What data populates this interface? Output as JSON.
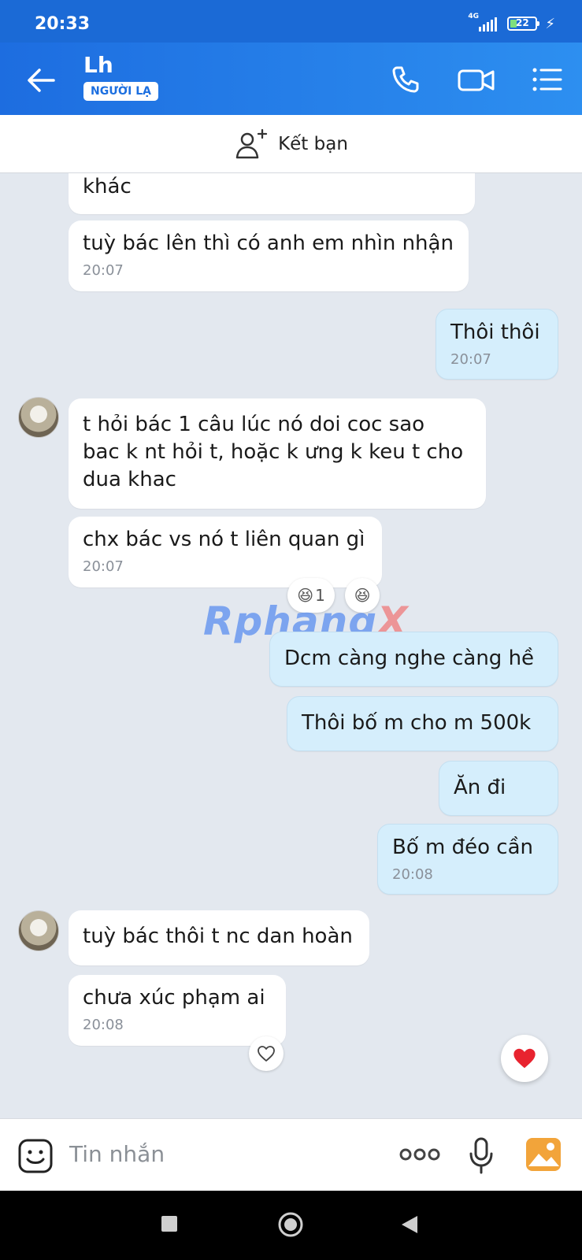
{
  "status": {
    "time": "20:33",
    "network": "4G",
    "battery": "22"
  },
  "header": {
    "name": "Lh",
    "badge": "NGƯỜI LẠ"
  },
  "friend_bar": {
    "label": "Kết bạn"
  },
  "messages": [
    {
      "dir": "in",
      "text": [
        "khác"
      ]
    },
    {
      "dir": "in",
      "text": [
        "tuỳ bác lên thì có anh em nhìn nhận"
      ],
      "time": "20:07"
    },
    {
      "dir": "out",
      "text": [
        "Thôi thôi"
      ],
      "time": "20:07"
    },
    {
      "dir": "in",
      "text": [
        "t hỏi bác 1 câu lúc nó doi coc sao",
        "bac k nt hỏi t, hoặc k ưng k keu t cho",
        "dua khac"
      ]
    },
    {
      "dir": "in",
      "text": [
        "chx bác vs nó t liên quan gì"
      ],
      "time": "20:07"
    },
    {
      "dir": "out",
      "text": [
        "Dcm càng nghe càng hề"
      ]
    },
    {
      "dir": "out",
      "text": [
        "Thôi bố m cho m 500k"
      ]
    },
    {
      "dir": "out",
      "text": [
        "Ăn đi"
      ]
    },
    {
      "dir": "out",
      "text": [
        "Bố m đéo cần"
      ],
      "time": "20:08"
    },
    {
      "dir": "in",
      "text": [
        "tuỳ bác thôi t nc dan hoàn"
      ]
    },
    {
      "dir": "in",
      "text": [
        "chưa xúc phạm ai"
      ],
      "time": "20:08"
    }
  ],
  "reactions": {
    "laugh_count": "1"
  },
  "watermark": {
    "main": "Rphang",
    "accent": "X"
  },
  "composer": {
    "placeholder": "Tin nhắn"
  },
  "colors": {
    "header": "#2d8ff0",
    "out_bubble": "#d5eefc",
    "background": "#e3e8ef",
    "heart": "#e8232f"
  }
}
